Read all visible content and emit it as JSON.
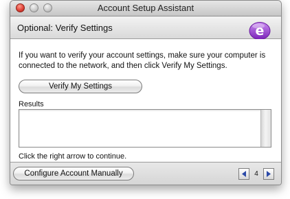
{
  "window": {
    "title": "Account Setup Assistant"
  },
  "header": {
    "title": "Optional: Verify Settings",
    "logo_icon": "entourage-e-icon"
  },
  "main": {
    "intro": "If you want to verify your account settings, make sure your computer is connected to the network, and then click Verify My Settings.",
    "verify_button": "Verify My Settings",
    "results_label": "Results",
    "results_text": "",
    "continue_hint": "Click the right arrow to continue."
  },
  "footer": {
    "configure_button": "Configure Account Manually",
    "page_number": "4",
    "prev_icon": "left-arrow-icon",
    "next_icon": "right-arrow-icon"
  },
  "colors": {
    "close_button": "#e0443a",
    "logo_purple": "#9b3fd0",
    "nav_arrow": "#2b4aa8"
  }
}
